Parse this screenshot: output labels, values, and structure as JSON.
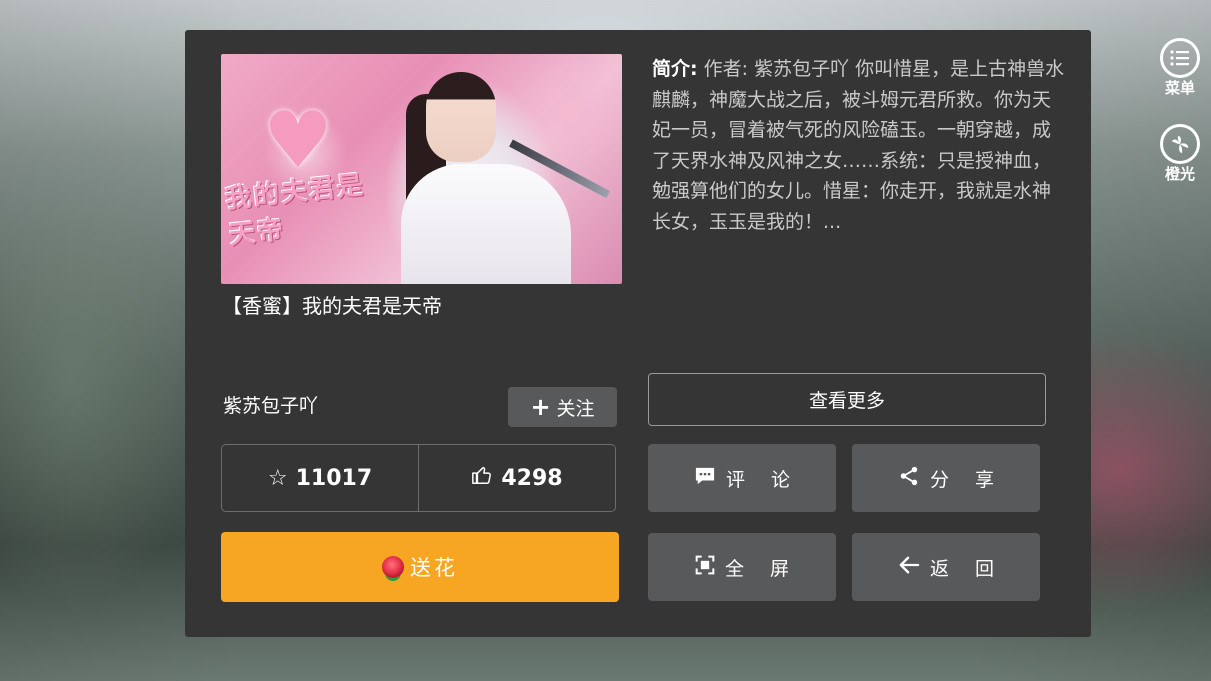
{
  "book": {
    "title": "【香蜜】我的夫君是天帝",
    "cover_text": "我的夫君是天帝",
    "intro_label": "简介:",
    "intro_text": " 作者: 紫苏包子吖 你叫惜星，是上古神兽水麒麟，神魔大战之后，被斗姆元君所救。你为天妃一员，冒着被气死的风险磕玉。一朝穿越，成了天界水神及风神之女……系统：只是授神血，勉强算他们的女儿。惜星：你走开，我就是水神长女，玉玉是我的！..."
  },
  "author": {
    "name": "紫苏包子吖",
    "follow_label": "关注"
  },
  "stats": {
    "favorites": "11017",
    "likes": "4298"
  },
  "buttons": {
    "send_flower": "送花",
    "view_more": "查看更多",
    "comment": "评论",
    "share": "分享",
    "fullscreen": "全屏",
    "back": "返回"
  },
  "side_menu": {
    "menu_label": "菜单",
    "orange_light_label": "橙光"
  },
  "icons": {
    "star": "star-outline-icon",
    "thumb": "thumbs-up-icon",
    "comment": "chat-bubble-icon",
    "share": "share-icon",
    "fullscreen": "fullscreen-icon",
    "back": "arrow-left-icon",
    "menu": "list-icon",
    "orange_light": "orange-light-logo-icon",
    "flower": "rose-icon"
  },
  "colors": {
    "panel": "#353536",
    "flower_button": "#f6a623",
    "action_button": "#58595b"
  }
}
